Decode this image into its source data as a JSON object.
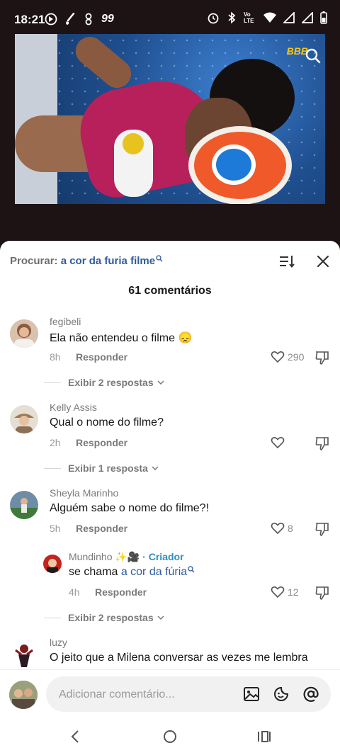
{
  "status_bar": {
    "time": "18:21",
    "notification_count": "99",
    "network_label": "Vo LTE"
  },
  "video": {
    "logo_text": "BBB"
  },
  "search": {
    "prefix": "Procurar:",
    "query": "a cor da furia filme"
  },
  "comments_count_label": "61 comentários",
  "comments": [
    {
      "username": "fegibeli",
      "text": "Ela não entendeu o filme 😞",
      "time": "8h",
      "reply_label": "Responder",
      "likes": "290",
      "view_replies": "Exibir 2 respostas"
    },
    {
      "username": "Kelly Assis",
      "text": "Qual o nome do filme?",
      "time": "2h",
      "reply_label": "Responder",
      "likes": "",
      "view_replies": "Exibir 1 resposta"
    },
    {
      "username": "Sheyla Marinho",
      "text": "Alguém sabe o nome do filme?!",
      "time": "5h",
      "reply_label": "Responder",
      "likes": "8",
      "view_replies": ""
    }
  ],
  "reply": {
    "username": "Mundinho",
    "username_emoji": "✨🎥",
    "badge": "· Criador",
    "text_prefix": "se chama ",
    "text_link": "a cor da fúria",
    "time": "4h",
    "reply_label": "Responder",
    "likes": "12",
    "view_replies": "Exibir 2 respostas"
  },
  "partial_comment": {
    "username": "luzy",
    "text": "O jeito que a Milena conversar as vezes me lembra"
  },
  "input": {
    "placeholder": "Adicionar comentário..."
  },
  "colors": {
    "accent_link": "#2e5b9c",
    "creator_badge": "#2e8fbf",
    "status_bar_bg": "#1d1315"
  }
}
